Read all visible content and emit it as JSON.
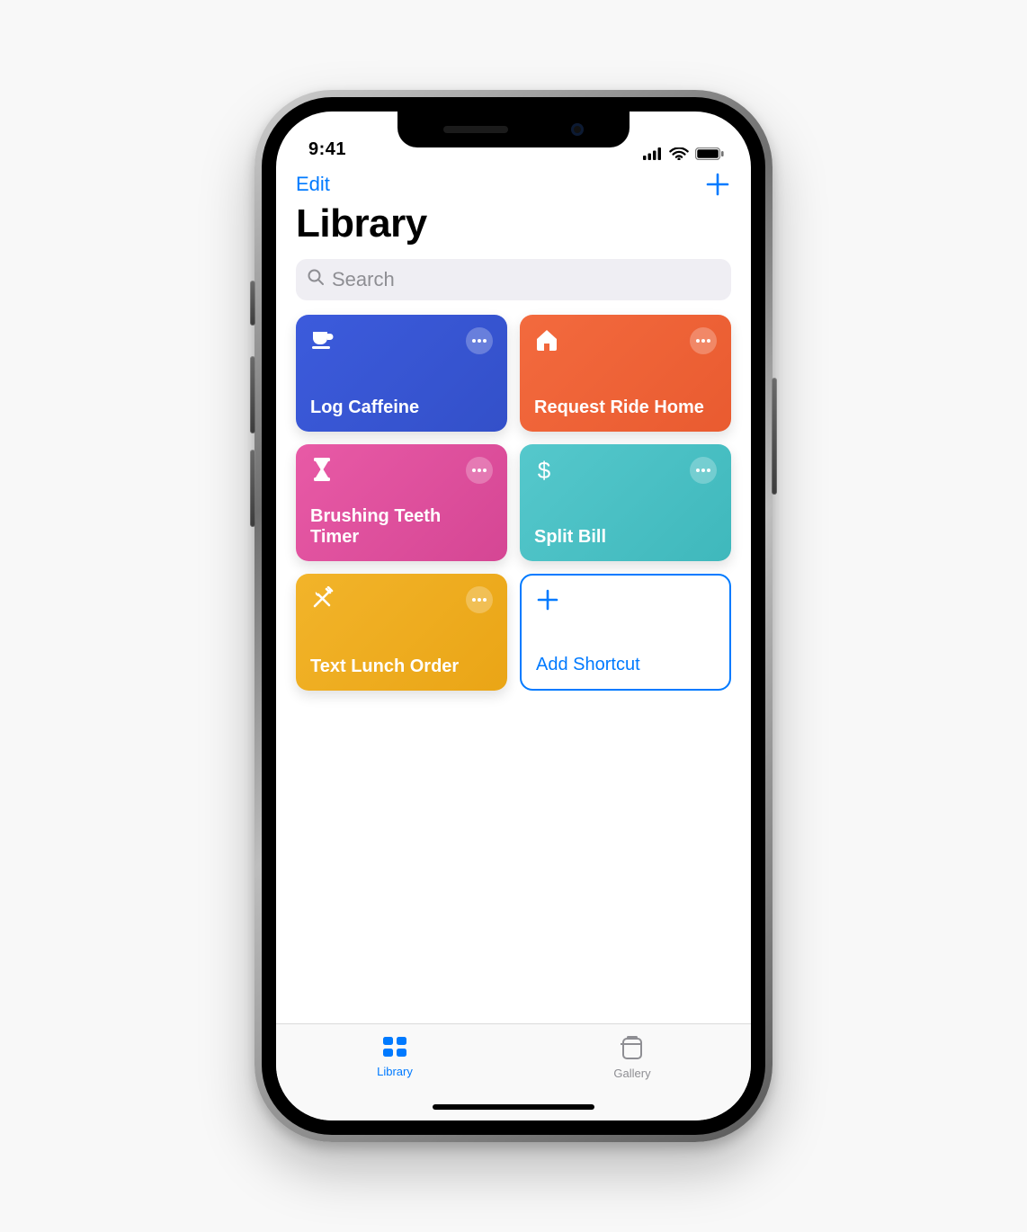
{
  "statusbar": {
    "time": "9:41"
  },
  "navbar": {
    "edit_label": "Edit"
  },
  "page": {
    "title": "Library"
  },
  "search": {
    "placeholder": "Search"
  },
  "colors": {
    "ios_blue": "#007aff",
    "tile_caffeine": "linear-gradient(135deg,#3c5bdc,#3350c9)",
    "tile_ride": "linear-gradient(135deg,#f36a3e,#e95b30)",
    "tile_teeth": "linear-gradient(135deg,#e85aa6,#d54694)",
    "tile_split": "linear-gradient(135deg,#55c8cc,#3fb8bc)",
    "tile_lunch": "linear-gradient(135deg,#f2b42a,#eaa516)"
  },
  "shortcuts": [
    {
      "id": "log-caffeine",
      "label": "Log Caffeine",
      "icon": "coffee-cup-icon",
      "color_key": "tile_caffeine"
    },
    {
      "id": "request-ride",
      "label": "Request Ride Home",
      "icon": "home-icon",
      "color_key": "tile_ride"
    },
    {
      "id": "brushing-teeth",
      "label": "Brushing Teeth Timer",
      "icon": "hourglass-icon",
      "color_key": "tile_teeth"
    },
    {
      "id": "split-bill",
      "label": "Split Bill",
      "icon": "dollar-icon",
      "color_key": "tile_split"
    },
    {
      "id": "text-lunch-order",
      "label": "Text Lunch Order",
      "icon": "utensils-icon",
      "color_key": "tile_lunch"
    }
  ],
  "add_tile": {
    "label": "Add Shortcut"
  },
  "tabs": {
    "library": {
      "label": "Library",
      "active": true
    },
    "gallery": {
      "label": "Gallery",
      "active": false
    }
  }
}
